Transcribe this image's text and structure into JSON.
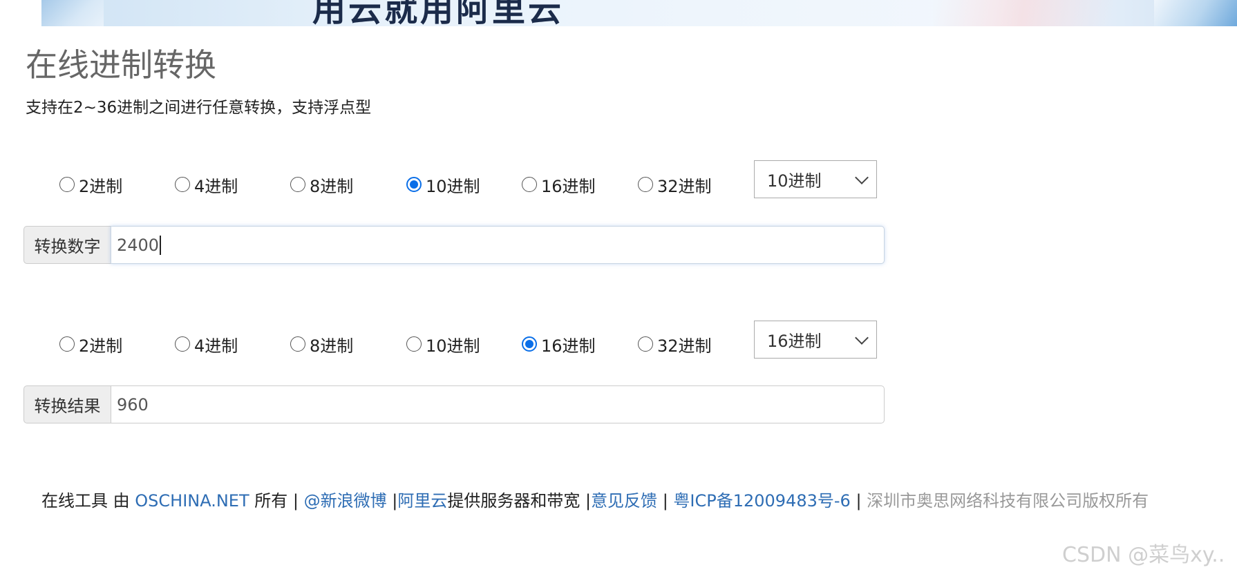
{
  "banner": {
    "text": "用云就用阿里云"
  },
  "page": {
    "title": "在线进制转换",
    "subtitle": "支持在2~36进制之间进行任意转换，支持浮点型"
  },
  "input_section": {
    "radios": [
      {
        "label": "2进制",
        "checked": false
      },
      {
        "label": "4进制",
        "checked": false
      },
      {
        "label": "8进制",
        "checked": false
      },
      {
        "label": "10进制",
        "checked": true
      },
      {
        "label": "16进制",
        "checked": false
      },
      {
        "label": "32进制",
        "checked": false
      }
    ],
    "select_value": "10进制",
    "addon_label": "转换数字",
    "value": "2400"
  },
  "output_section": {
    "radios": [
      {
        "label": "2进制",
        "checked": false
      },
      {
        "label": "4进制",
        "checked": false
      },
      {
        "label": "8进制",
        "checked": false
      },
      {
        "label": "10进制",
        "checked": false
      },
      {
        "label": "16进制",
        "checked": true
      },
      {
        "label": "32进制",
        "checked": false
      }
    ],
    "select_value": "16进制",
    "addon_label": "转换结果",
    "value": "960"
  },
  "footer": {
    "prefix": "在线工具 由 ",
    "oschina": "OSCHINA.NET",
    "owned": " 所有 | ",
    "weibo": "@新浪微博",
    "sep1": " |",
    "aliyun": "阿里云",
    "bandwidth": "提供服务器和带宽 |",
    "feedback": "意见反馈",
    "sep2": " | ",
    "icp": "粤ICP备12009483号-6",
    "sep3": " | ",
    "copyright": "深圳市奥思网络科技有限公司版权所有"
  },
  "watermark": "CSDN @菜鸟xy.."
}
